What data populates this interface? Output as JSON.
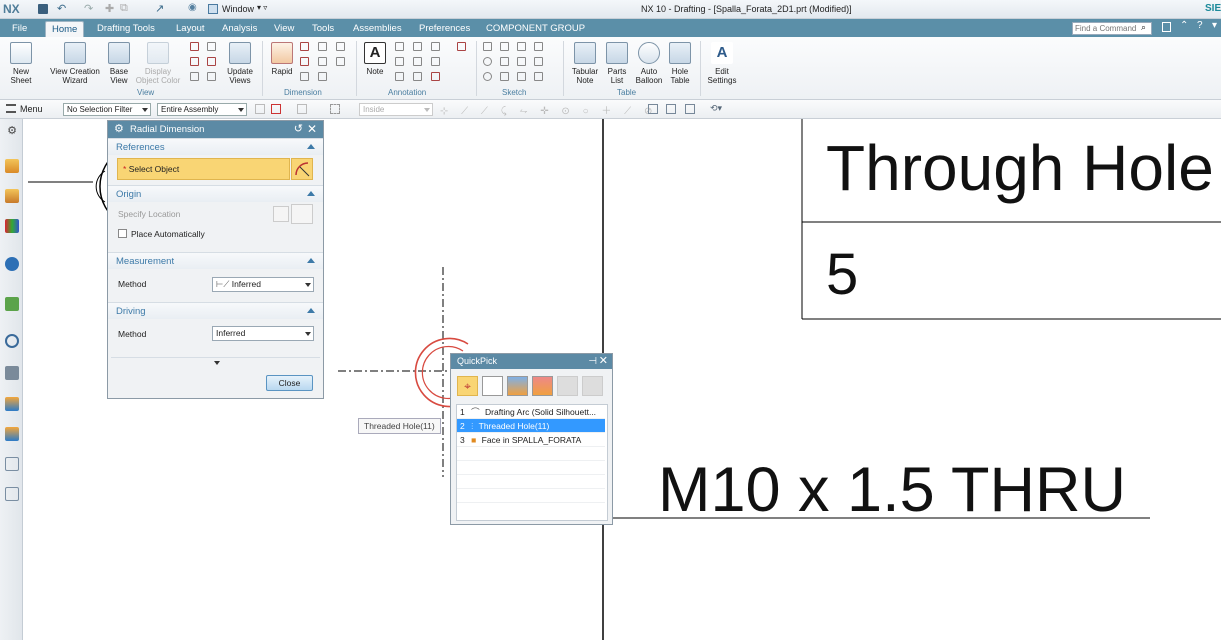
{
  "titlebar": {
    "logo": "NX",
    "window_menu": "Window",
    "title": "NX 10 - Drafting - [Spalla_Forata_2D1.prt (Modified)]",
    "brand": "SIE"
  },
  "tabs": {
    "file": "File",
    "items": [
      "Home",
      "Drafting Tools",
      "Layout",
      "Analysis",
      "View",
      "Tools",
      "Assemblies",
      "Preferences",
      "COMPONENT GROUP"
    ],
    "active": "Home"
  },
  "command_search": {
    "placeholder": "Find a Command"
  },
  "ribbon": {
    "view_group": {
      "label": "View",
      "buttons": [
        "New Sheet",
        "View Creation Wizard",
        "Base View",
        "Display Object Color",
        "Update Views"
      ]
    },
    "dimension_group": {
      "label": "Dimension",
      "buttons": [
        "Rapid"
      ]
    },
    "annotation_group": {
      "label": "Annotation",
      "buttons": [
        "Note"
      ]
    },
    "sketch_group": {
      "label": "Sketch"
    },
    "table_group": {
      "label": "Table",
      "buttons": [
        "Tabular Note",
        "Parts List",
        "Auto Balloon",
        "Hole Table"
      ]
    },
    "settings_group": {
      "buttons": [
        "Edit Settings"
      ]
    }
  },
  "toolbar": {
    "menu": "Menu",
    "selection_filter": "No Selection Filter",
    "scope": "Entire Assembly",
    "inside": "Inside"
  },
  "radial_dialog": {
    "title": "Radial Dimension",
    "references": {
      "header": "References",
      "select_object": "Select Object"
    },
    "origin": {
      "header": "Origin",
      "specify_location": "Specify Location",
      "place_automatically": "Place Automatically"
    },
    "measurement": {
      "header": "Measurement",
      "method_label": "Method",
      "method_value": "Inferred"
    },
    "driving": {
      "header": "Driving",
      "method_label": "Method",
      "method_value": "Inferred"
    },
    "close_button": "Close"
  },
  "quickpick": {
    "title": "QuickPick",
    "items": [
      {
        "index": "1",
        "label": "Drafting Arc (Solid Silhouett..."
      },
      {
        "index": "2",
        "label": "Threaded Hole(11)"
      },
      {
        "index": "3",
        "label": "Face in SPALLA_FORATA"
      }
    ],
    "selected_index": 1
  },
  "tooltip": {
    "text": "Threaded Hole(11)"
  },
  "drawing": {
    "table_header": "Through Hole",
    "table_value": "5",
    "callout": "M10 x 1.5 THRU"
  },
  "colors": {
    "tab_bar": "#5b8fa8",
    "dialog_header": "#5c8aa5",
    "select_highlight": "#f9d574",
    "quickpick_selected": "#3399ff",
    "arc_red": "#d84a40"
  }
}
